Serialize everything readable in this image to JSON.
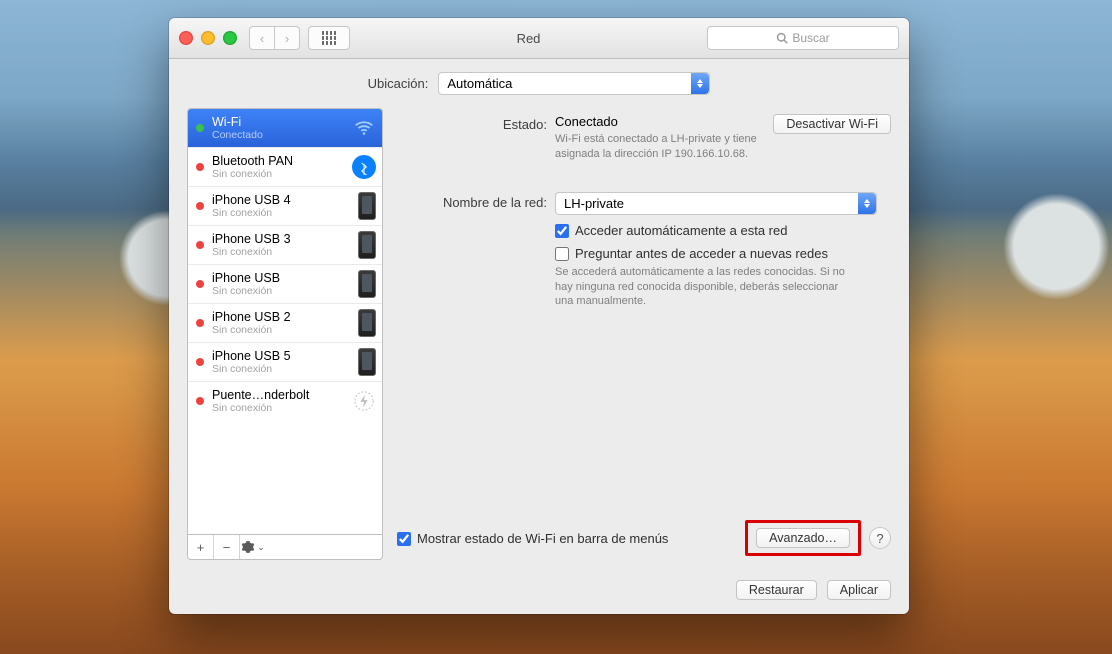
{
  "window": {
    "title": "Red",
    "search_placeholder": "Buscar"
  },
  "location": {
    "label": "Ubicación:",
    "value": "Automática"
  },
  "sidebar": {
    "items": [
      {
        "name": "Wi-Fi",
        "status": "Conectado",
        "dot": "green",
        "icon": "wifi",
        "selected": true
      },
      {
        "name": "Bluetooth PAN",
        "status": "Sin conexión",
        "dot": "red",
        "icon": "bt"
      },
      {
        "name": "iPhone USB 4",
        "status": "Sin conexión",
        "dot": "red",
        "icon": "phone"
      },
      {
        "name": "iPhone USB 3",
        "status": "Sin conexión",
        "dot": "red",
        "icon": "phone"
      },
      {
        "name": "iPhone USB",
        "status": "Sin conexión",
        "dot": "red",
        "icon": "phone"
      },
      {
        "name": "iPhone USB 2",
        "status": "Sin conexión",
        "dot": "red",
        "icon": "phone"
      },
      {
        "name": "iPhone USB 5",
        "status": "Sin conexión",
        "dot": "red",
        "icon": "phone"
      },
      {
        "name": "Puente…nderbolt",
        "status": "Sin conexión",
        "dot": "red",
        "icon": "thunder"
      }
    ],
    "tools": {
      "add": "+",
      "remove": "−",
      "gear_caret": "⌄"
    }
  },
  "panel": {
    "estado_label": "Estado:",
    "estado_value": "Conectado",
    "turn_off": "Desactivar Wi-Fi",
    "estado_hint": "Wi-Fi está conectado a LH-private y tiene asignada la dirección IP 190.166.10.68.",
    "network_label": "Nombre de la red:",
    "network_value": "LH-private",
    "auto_join": "Acceder automáticamente a esta red",
    "ask_join": "Preguntar antes de acceder a nuevas redes",
    "ask_hint": "Se accederá automáticamente a las redes conocidas. Si no hay ninguna red conocida disponible, deberás seleccionar una manualmente.",
    "show_menu": "Mostrar estado de Wi-Fi en barra de menús",
    "advanced": "Avanzado…",
    "help": "?"
  },
  "footer": {
    "restore": "Restaurar",
    "apply": "Aplicar"
  }
}
